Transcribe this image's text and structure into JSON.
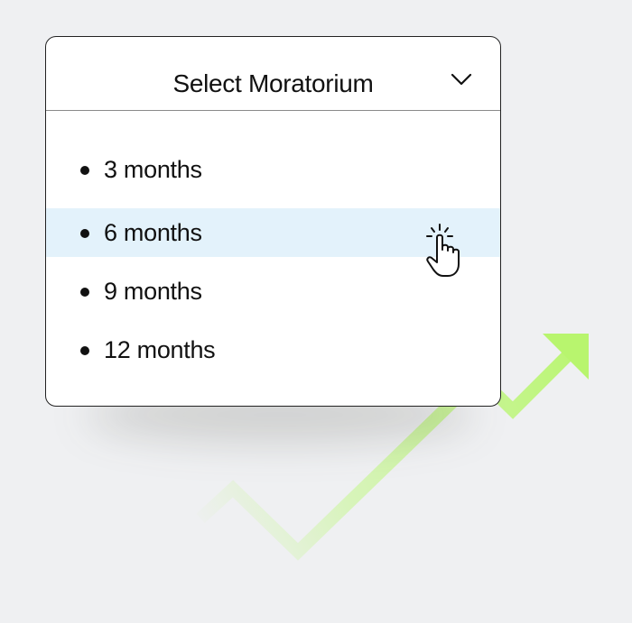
{
  "dropdown": {
    "title": "Select Moratorium",
    "selected_index": 1,
    "options": [
      {
        "label": "3 months"
      },
      {
        "label": "6 months"
      },
      {
        "label": "9 months"
      },
      {
        "label": "12 months"
      }
    ]
  },
  "icons": {
    "chevron": "chevron-down-icon",
    "cursor": "pointing-hand-click-icon",
    "trend": "trend-up-arrow-icon"
  },
  "colors": {
    "background": "#eff0f2",
    "card": "#ffffff",
    "selected_row": "#e3f2fb",
    "trend_arrow": "#b8f56e"
  }
}
